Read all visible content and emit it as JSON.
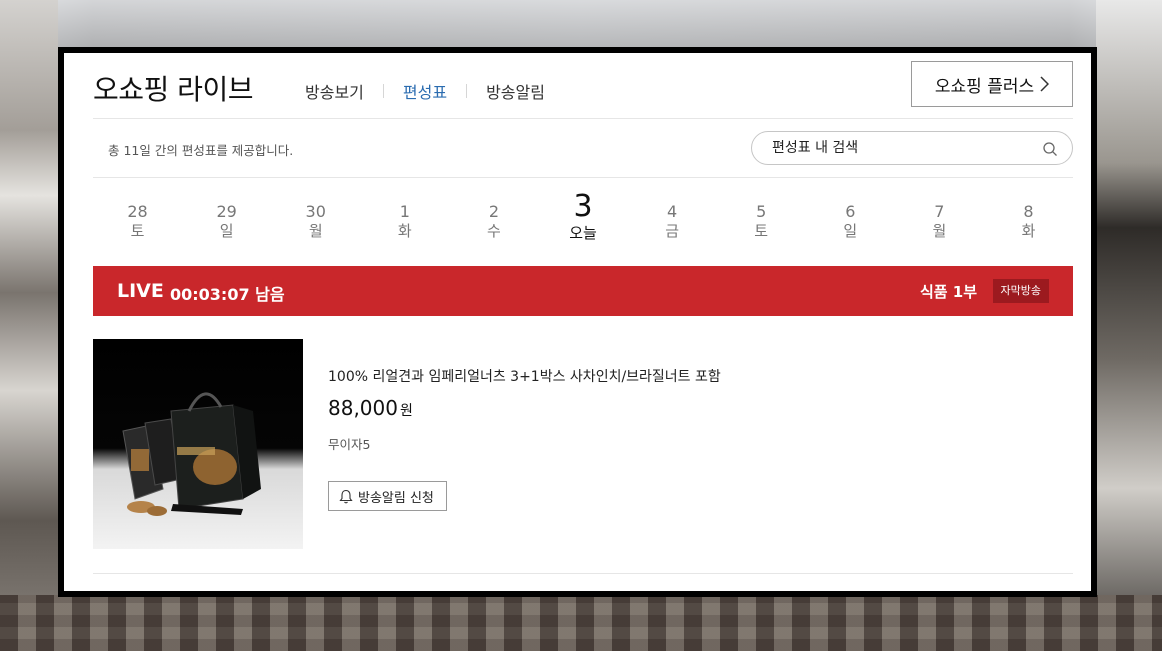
{
  "header": {
    "brand": "오쇼핑 라이브",
    "nav": [
      {
        "label": "방송보기",
        "active": false
      },
      {
        "label": "편성표",
        "active": true
      },
      {
        "label": "방송알림",
        "active": false
      }
    ],
    "plus_button": "오쇼핑 플러스"
  },
  "info": {
    "text": "총 11일 간의 편성표를 제공합니다.",
    "search_placeholder": "편성표 내 검색"
  },
  "dates": [
    {
      "num": "28",
      "day": "토"
    },
    {
      "num": "29",
      "day": "일"
    },
    {
      "num": "30",
      "day": "월"
    },
    {
      "num": "1",
      "day": "화"
    },
    {
      "num": "2",
      "day": "수"
    },
    {
      "num": "3",
      "day": "오늘",
      "today": true
    },
    {
      "num": "4",
      "day": "금"
    },
    {
      "num": "5",
      "day": "토"
    },
    {
      "num": "6",
      "day": "일"
    },
    {
      "num": "7",
      "day": "월"
    },
    {
      "num": "8",
      "day": "화"
    }
  ],
  "live": {
    "tag": "LIVE",
    "remaining": "00:03:07 남음",
    "category": "식품 1부",
    "badge": "자막방송"
  },
  "product": {
    "title": "100% 리얼견과 임페리얼너츠 3+1박스 사차인치/브라질너트 포함",
    "price": "88,000",
    "unit": "원",
    "promo": "무이자5",
    "alarm_button": "방송알림 신청"
  },
  "colors": {
    "live_bar": "#c9272b",
    "live_badge": "#9c1a1f",
    "nav_active": "#2b6cb0"
  }
}
